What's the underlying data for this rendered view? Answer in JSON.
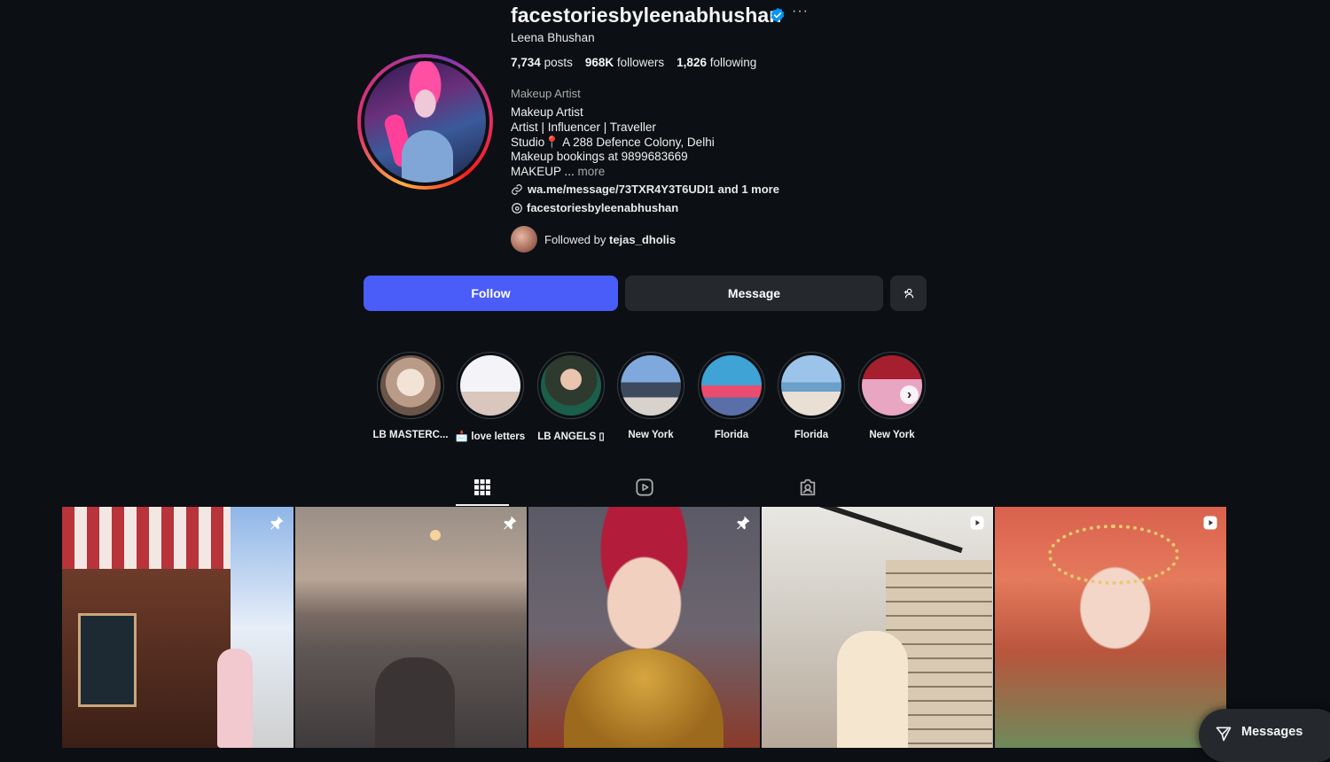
{
  "profile": {
    "username": "facestoriesbyleenabhushan",
    "full_name": "Leena Bhushan",
    "stats": {
      "posts_count": "7,734",
      "posts_label": "posts",
      "followers_count": "968K",
      "followers_label": "followers",
      "following_count": "1,826",
      "following_label": "following"
    },
    "category": "Makeup Artist",
    "bio_lines": [
      "Makeup Artist",
      "Artist | Influencer | Traveller",
      "Studio📍 A 288 Defence Colony, Delhi",
      "Makeup bookings at 9899683669",
      "MAKEUP ..."
    ],
    "bio_more": "more",
    "link_text": "wa.me/message/73TXR4Y3T6UDI1 and 1 more",
    "threads_handle": "facestoriesbyleenabhushan",
    "followed_by_prefix": "Followed by",
    "followed_by_user": "tejas_dholis"
  },
  "actions": {
    "follow": "Follow",
    "message": "Message"
  },
  "highlights": [
    {
      "label": "LB MASTERC..."
    },
    {
      "label": "📩 love letters"
    },
    {
      "label": "LB ANGELS ▯"
    },
    {
      "label": "New York"
    },
    {
      "label": "Florida"
    },
    {
      "label": "Florida"
    },
    {
      "label": "New York"
    }
  ],
  "tabs": [
    "posts-grid",
    "reels",
    "tagged"
  ],
  "posts": [
    {
      "badge": "pin-icon"
    },
    {
      "badge": "pin-icon"
    },
    {
      "badge": "pin-icon"
    },
    {
      "badge": "reel-icon"
    },
    {
      "badge": "reel-icon"
    }
  ],
  "messages_label": "Messages",
  "colors": {
    "background": "#0c1014",
    "follow_button": "#4a5df9",
    "secondary_button": "#25292e",
    "verified": "#0095f6"
  }
}
